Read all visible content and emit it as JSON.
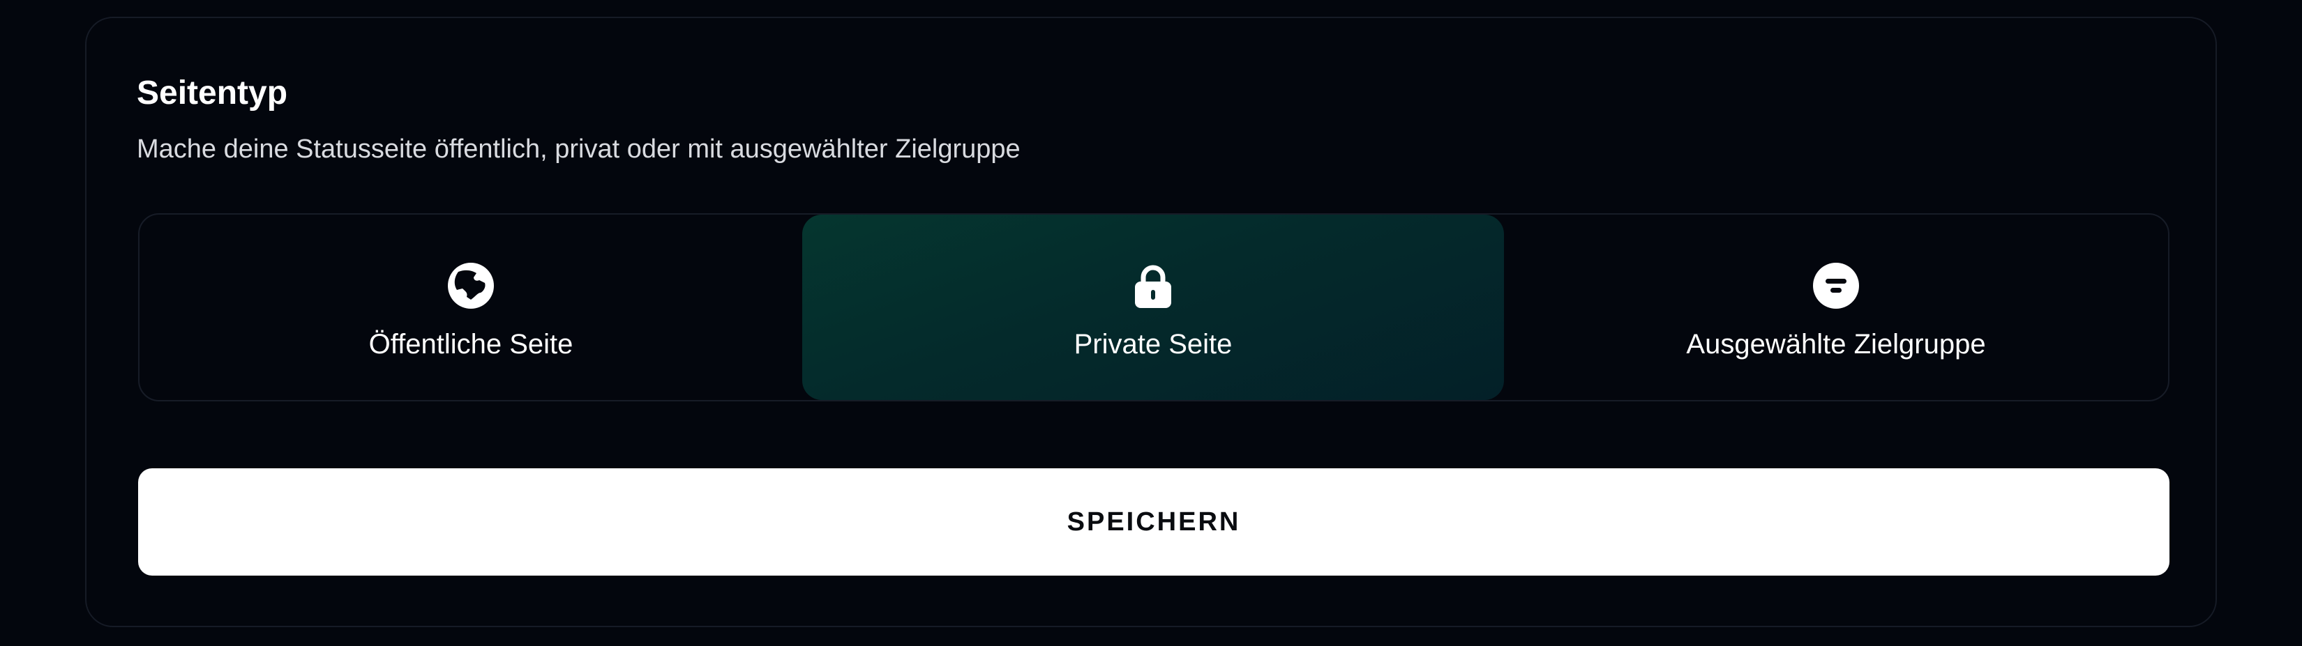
{
  "section": {
    "title": "Seitentyp",
    "description": "Mache deine Statusseite öffentlich, privat oder mit ausgewählter Zielgruppe"
  },
  "page_type_options": [
    {
      "label": "Öffentliche Seite",
      "icon": "globe-icon",
      "selected": false
    },
    {
      "label": "Private Seite",
      "icon": "lock-icon",
      "selected": true
    },
    {
      "label": "Ausgewählte Zielgruppe",
      "icon": "filter-icon",
      "selected": false
    }
  ],
  "actions": {
    "save_label": "SPEICHERN"
  },
  "colors": {
    "background": "#03060d",
    "card_border": "#161b26",
    "selected_option_bg": "#05362f",
    "button_bg": "#ffffff",
    "button_text": "#0a0c10",
    "text_primary": "#ffffff",
    "text_secondary": "#d9dbe0"
  }
}
